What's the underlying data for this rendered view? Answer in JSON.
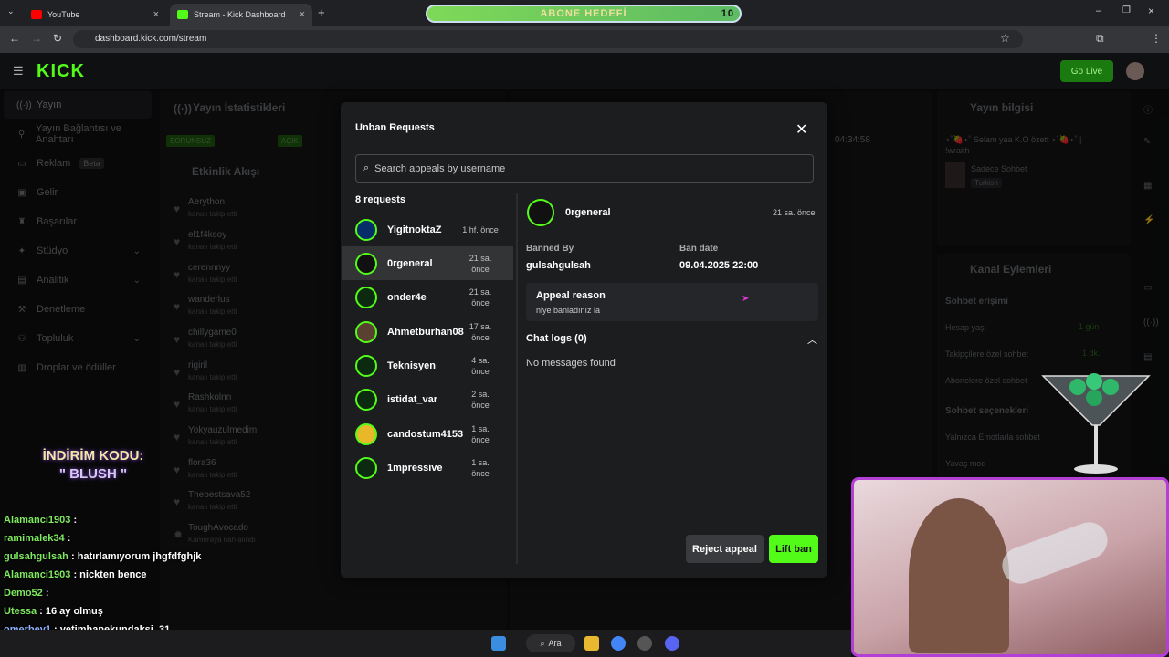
{
  "browser": {
    "tabs": [
      {
        "label": "YouTube"
      },
      {
        "label": "Stream - Kick Dashboard"
      }
    ],
    "url": "dashboard.kick.com/stream",
    "abone_hedefi": {
      "label": "ABONE HEDEFİ",
      "count": "10"
    }
  },
  "kick": {
    "logo": "KICK",
    "go_live": "Go Live"
  },
  "sidebar": {
    "items": [
      {
        "label": "Yayın"
      },
      {
        "label": "Yayın Bağlantısı ve Anahtarı"
      },
      {
        "label": "Reklam",
        "badge": "Beta"
      },
      {
        "label": "Gelir"
      },
      {
        "label": "Başarılar"
      },
      {
        "label": "Stüdyo"
      },
      {
        "label": "Analitik"
      },
      {
        "label": "Denetleme"
      },
      {
        "label": "Topluluk"
      },
      {
        "label": "Droplar ve ödüller"
      }
    ]
  },
  "background": {
    "stats_title": "Yayın İstatistikleri",
    "activity_title": "Etkinlik Akışı",
    "badge_sorunsuz": "SORUNSUZ",
    "badge_acik": "AÇIK",
    "timer": "04:34:58",
    "info_title": "Yayın bilgisi",
    "info_text": "⋆˚🍓⋆˚ Selam yaa K.O özett ⋆˚🍓⋆˚ | !wraith",
    "category": "Sadece Sohbet",
    "language": "Turkish",
    "actions_title": "Kanal Eylemleri",
    "chat_access": "Sohbet erişimi",
    "account_age": "Hesap yaşı",
    "account_age_val": "1 gün",
    "followers_only": "Takipçilere özel sohbet",
    "followers_only_val": "1 dk.",
    "subs_only": "Abonelere özel sohbet",
    "chat_options": "Sohbet seçenekleri",
    "emote_only": "Yalnızca Emotlarla sohbet",
    "slow_mode": "Yavaş mod",
    "followers": [
      {
        "name": "Aerython",
        "sub": "kanalı takip etti"
      },
      {
        "name": "el1f4ksoy",
        "sub": "kanalı takip etti"
      },
      {
        "name": "cerennnyy",
        "sub": "kanalı takip etti"
      },
      {
        "name": "wanderlus",
        "sub": "kanalı takip etti"
      },
      {
        "name": "chillygame0",
        "sub": "kanalı takip etti"
      },
      {
        "name": "rigiril",
        "sub": "kanalı takip etti"
      },
      {
        "name": "Rashkolnn",
        "sub": "kanalı takip etti"
      },
      {
        "name": "Yokyauzulmedim",
        "sub": "kanalı takip etti"
      },
      {
        "name": "flora36",
        "sub": "kanalı takip etti"
      },
      {
        "name": "Thebestsava52",
        "sub": "kanalı takip etti"
      },
      {
        "name": "ToughAvocado",
        "sub": "Kameraya nah alındı"
      }
    ]
  },
  "modal": {
    "title": "Unban Requests",
    "search_placeholder": "Search appeals by username",
    "count_label": "8 requests",
    "requests": [
      {
        "name": "YigitnoktaZ",
        "time": "1 hf. önce"
      },
      {
        "name": "0rgeneral",
        "time": "21 sa. önce"
      },
      {
        "name": "onder4e",
        "time": "21 sa. önce"
      },
      {
        "name": "Ahmetburhan08",
        "time": "17 sa. önce"
      },
      {
        "name": "Teknisyen",
        "time": "4 sa. önce"
      },
      {
        "name": "istidat_var",
        "time": "2 sa. önce"
      },
      {
        "name": "candostum4153",
        "time": "1 sa. önce"
      },
      {
        "name": "1mpressive",
        "time": "1 sa. önce"
      }
    ],
    "selected_index": 1,
    "detail": {
      "name": "0rgeneral",
      "time": "21 sa. önce",
      "banned_by_label": "Banned By",
      "banned_by": "gulsahgulsah",
      "ban_date_label": "Ban date",
      "ban_date": "09.04.2025 22:00",
      "reason_label": "Appeal reason",
      "reason": "niye banladınız la",
      "chat_logs_label": "Chat logs (0)",
      "no_messages": "No messages found"
    },
    "reject_label": "Reject appeal",
    "lift_label": "Lift ban"
  },
  "overlay": {
    "promo_line1": "İNDİRİM KODU:",
    "promo_line2": "\" BLUSH \"",
    "chat": [
      {
        "user": "Alamanci1903",
        "msg": ""
      },
      {
        "user": "ramimalek34",
        "msg": ""
      },
      {
        "user": "gulsahgulsah",
        "msg": "hatırlamıyorum jhgfdfghjk"
      },
      {
        "user": "Alamanci1903",
        "msg": "nickten bence"
      },
      {
        "user": "Demo52",
        "msg": ""
      },
      {
        "user": "Utessa",
        "msg": "16 ay olmuş"
      },
      {
        "user": "omerbey1",
        "msg": "yetimhanekundaksi_31"
      }
    ]
  },
  "taskbar": {
    "search_label": "Ara"
  },
  "colors": {
    "accent": "#53fc18",
    "modal_bg": "#1c1d1f",
    "selected_row": "#333436"
  }
}
